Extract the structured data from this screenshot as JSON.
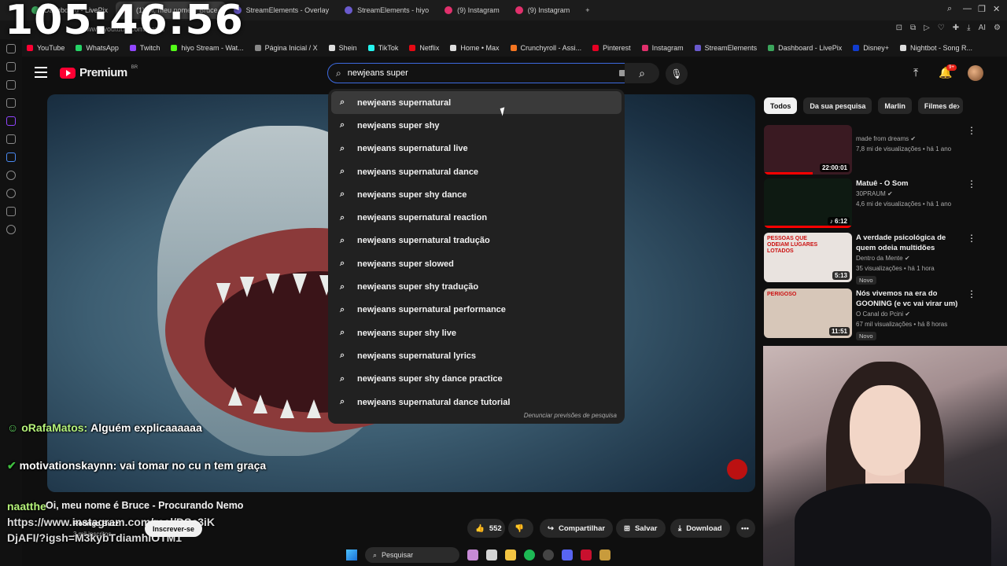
{
  "overlay": {
    "clock": "105:46:56"
  },
  "browser": {
    "tabs": [
      {
        "label": "Dashboard - LivePix",
        "color": "#3ba55c"
      },
      {
        "label": "(1) Oi, meu nome é Bruce",
        "color": "#ff0033"
      },
      {
        "label": "StreamElements - Overlay",
        "color": "#6a5acd"
      },
      {
        "label": "StreamElements - hiyo",
        "color": "#6a5acd"
      },
      {
        "label": "(9) Instagram",
        "color": "#e1306c"
      },
      {
        "label": "(9) Instagram",
        "color": "#e1306c"
      }
    ],
    "new_tab": "+",
    "url": "www.youtube.com/watch",
    "ext_ai": "AI",
    "bookmarks": [
      {
        "label": "YouTube",
        "color": "#ff0033"
      },
      {
        "label": "WhatsApp",
        "color": "#25d366"
      },
      {
        "label": "Twitch",
        "color": "#9146ff"
      },
      {
        "label": "hiyo Stream - Wat...",
        "color": "#53fc18"
      },
      {
        "label": "Página Inicial / X",
        "color": "#888888"
      },
      {
        "label": "Shein",
        "color": "#dddddd"
      },
      {
        "label": "TikTok",
        "color": "#25f4ee"
      },
      {
        "label": "Netflix",
        "color": "#e50914"
      },
      {
        "label": "Home • Max",
        "color": "#dddddd"
      },
      {
        "label": "Crunchyroll - Assi...",
        "color": "#f47521"
      },
      {
        "label": "Pinterest",
        "color": "#e60023"
      },
      {
        "label": "Instagram",
        "color": "#e1306c"
      },
      {
        "label": "StreamElements",
        "color": "#6a5acd"
      },
      {
        "label": "Dashboard - LivePix",
        "color": "#3ba55c"
      },
      {
        "label": "Disney+",
        "color": "#113ccf"
      },
      {
        "label": "Nightbot - Song R...",
        "color": "#dddddd"
      }
    ]
  },
  "header": {
    "logo_text": "Premium",
    "country": "BR",
    "search_value": "newjeans super",
    "notification_count": "9+"
  },
  "suggestions": [
    "newjeans supernatural",
    "newjeans super shy",
    "newjeans supernatural live",
    "newjeans supernatural dance",
    "newjeans super shy dance",
    "newjeans supernatural reaction",
    "newjeans supernatural tradução",
    "newjeans super slowed",
    "newjeans super shy tradução",
    "newjeans supernatural performance",
    "newjeans super shy live",
    "newjeans supernatural lyrics",
    "newjeans super shy dance practice",
    "newjeans supernatural dance tutorial"
  ],
  "report_text": "Denunciar previsões de pesquisa",
  "chips": [
    "Todos",
    "Da sua pesquisa",
    "Marlin",
    "Filmes de"
  ],
  "recommendations": [
    {
      "title": "",
      "channel": "made from dreams",
      "meta": "7,8 mi de visualizações • há 1 ano",
      "duration": "22:00:01",
      "badge": "",
      "thumb": "#3a1a22",
      "progress": 0.55
    },
    {
      "title": "Matuê - O Som",
      "channel": "30PRAUM",
      "meta": "4,6 mi de visualizações • há 1 ano",
      "duration": "♪ 6:12",
      "badge": "",
      "thumb": "#0e1a12",
      "progress": 1.0
    },
    {
      "title": "A verdade psicológica de quem odeia multidões",
      "channel": "Dentro da Mente",
      "meta": "35 visualizações • há 1 hora",
      "duration": "5:13",
      "badge": "Novo",
      "thumb": "#e9e3df",
      "thumb_text": "PESSOAS QUE ODEIAM LUGARES LOTADOS",
      "progress": 0
    },
    {
      "title": "Nós vivemos na era do GOONING (e vc vai virar um)",
      "channel": "O Canal do Pcini",
      "meta": "67 mil visualizações • há 8 horas",
      "duration": "11:51",
      "badge": "Novo",
      "thumb": "#d7c7b9",
      "thumb_text": "PERIGOSO",
      "progress": 0
    }
  ],
  "chat": [
    {
      "user": "oRafaMatos:",
      "text": "Alguém explicaaaaaa"
    },
    {
      "user": "motivationskaynn:",
      "text": "vai tomar no cu n tem graça"
    },
    {
      "user": "naatthe",
      "text": "https://www.instagram.com/reel/DSc3iKDjAFI/?igsh=M3kybTdiamhlOTM1"
    }
  ],
  "video": {
    "title": "Oi, meu nome é Bruce - Procurando Nemo",
    "channel": "Rodrigo Buzz",
    "subs": "3 mil inscritos",
    "subscribe": "Inscrever-se",
    "likes": "552",
    "share": "Compartilhar",
    "save": "Salvar",
    "download": "Download"
  },
  "taskbar": {
    "search_placeholder": "Pesquisar"
  }
}
